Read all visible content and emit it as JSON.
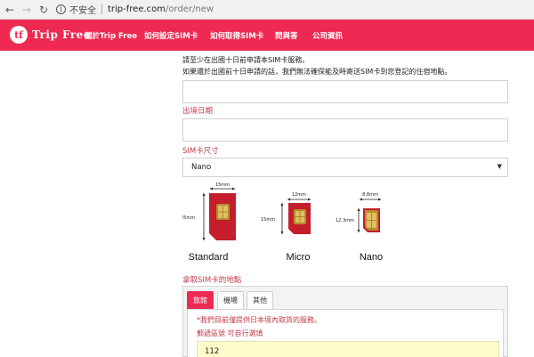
{
  "browser": {
    "security_label": "不安全",
    "url_host": "trip-free.com",
    "url_path": "/order/new"
  },
  "header": {
    "brand": "Trip Free",
    "logo_glyph": "tf",
    "nav": [
      "關於Trip Free",
      "如何設定SIM卡",
      "如何取得SIM卡",
      "問與答",
      "公司資訊"
    ],
    "accent_color": "#ee2a52"
  },
  "form": {
    "notice_line1": "請至少在出國十日前申請本SIM卡服務。",
    "notice_line2": "如果還於出國前十日申請的話，我們無法確保能及時寄送SIM卡到您登記的住宿地點。",
    "departure_label": "出境日期",
    "sim_size_label": "SIM卡尺寸",
    "sim_size_value": "Nano",
    "sims": [
      {
        "name": "Standard",
        "width": "15mm",
        "height": "25mm"
      },
      {
        "name": "Micro",
        "width": "12mm",
        "height": "15mm"
      },
      {
        "name": "Nano",
        "width": "8.8mm",
        "height": "12.3mm"
      }
    ],
    "pickup_label": "拿取SIM卡的地點",
    "tabs": [
      "旅館",
      "機場",
      "其他"
    ],
    "tab_note": "*我們目前僅提供日本境內取貨的服務。",
    "postal_label": "郵遞區號  可自行選填",
    "postal_value": "112"
  }
}
